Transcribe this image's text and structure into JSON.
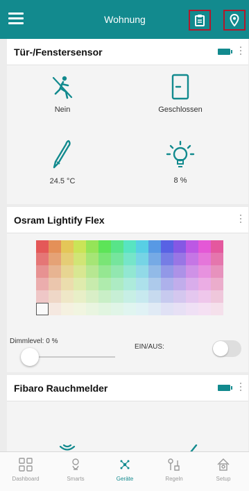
{
  "header": {
    "title": "Wohnung",
    "menu_icon": "hamburger-icon",
    "clipboard_icon": "clipboard-icon",
    "location_icon": "location-pin-icon",
    "accent_color": "#128a8e",
    "highlight_color": "#b2182b"
  },
  "door_sensor": {
    "title": "Tür-/Fenstersensor",
    "battery_icon": "battery-icon",
    "cells": [
      {
        "icon": "motion-icon",
        "label": "Nein"
      },
      {
        "icon": "door-icon",
        "label": "Geschlossen"
      },
      {
        "icon": "thermometer-icon",
        "label": "24.5 °C"
      },
      {
        "icon": "lightbulb-icon",
        "label": "8 %"
      }
    ]
  },
  "light": {
    "title": "Osram Lightify Flex",
    "dimm_label": "Dimmlevel: 0 %",
    "dimm_level": 0,
    "switch_label": "EIN/AUS:",
    "switch_on": false
  },
  "smoke": {
    "title": "Fibaro Rauchmelder",
    "battery_icon": "battery-icon"
  },
  "tabs": [
    {
      "label": "Dashboard",
      "icon": "dashboard-icon",
      "active": false
    },
    {
      "label": "Smarts",
      "icon": "smarts-icon",
      "active": false
    },
    {
      "label": "Geräte",
      "icon": "devices-icon",
      "active": true
    },
    {
      "label": "Regeln",
      "icon": "rules-icon",
      "active": false
    },
    {
      "label": "Setup",
      "icon": "setup-icon",
      "active": false
    }
  ]
}
